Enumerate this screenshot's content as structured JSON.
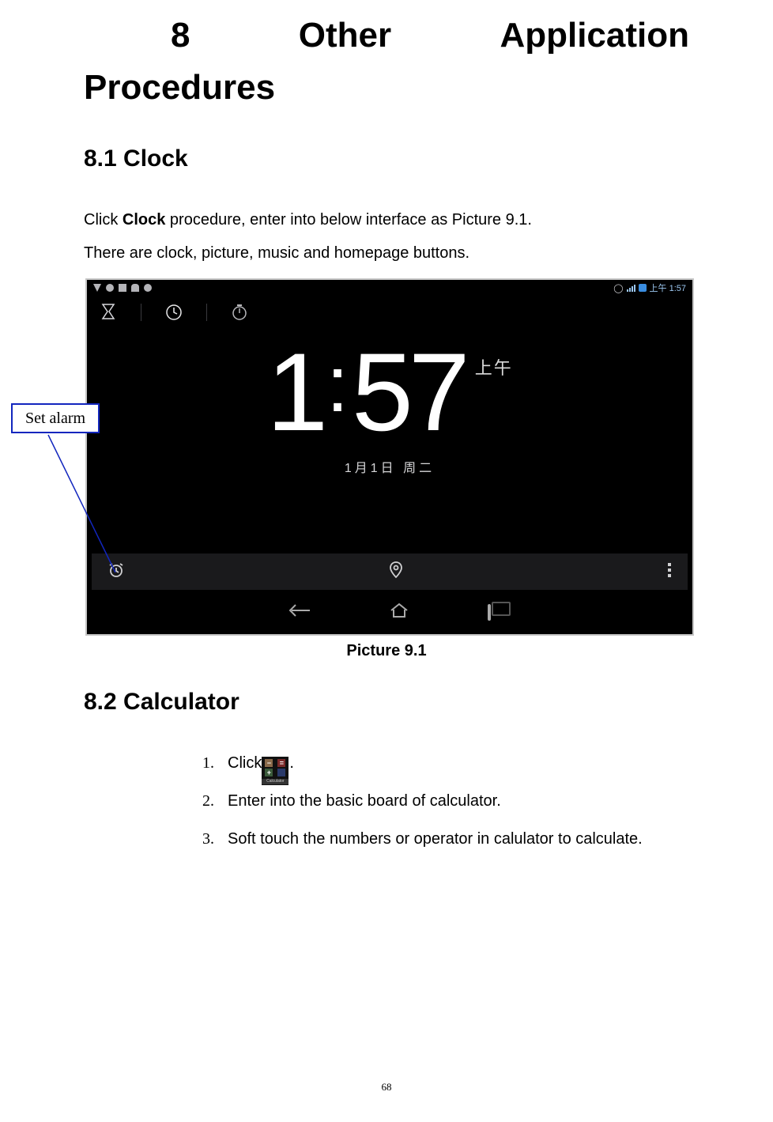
{
  "page_number": "68",
  "heading": {
    "number": "8",
    "word2": "Other",
    "word3": "Application",
    "line2": "Procedures"
  },
  "section_clock": {
    "title": "8.1 Clock",
    "para1_prefix": "Click ",
    "para1_bold": "Clock",
    "para1_suffix": " procedure, enter into below interface as Picture 9.1.",
    "para2": "There are clock, picture, music and homepage buttons."
  },
  "figure": {
    "caption": "Picture 9.1",
    "statusbar_time": "上午 1:57",
    "clock_hour": "1",
    "clock_minute": "57",
    "clock_ampm": "上午",
    "clock_date": "1月1日 周二"
  },
  "callout_label": "Set alarm",
  "section_calc": {
    "title": "8.2 Calculator",
    "steps_num": [
      "1.",
      "2.",
      "3."
    ],
    "step1_prefix": "Click",
    "step1_suffix": ".",
    "calc_icon_label": "Calculator",
    "step2": "Enter into the basic board of calculator.",
    "step3": "Soft touch the numbers or operator in calulator to calculate."
  }
}
